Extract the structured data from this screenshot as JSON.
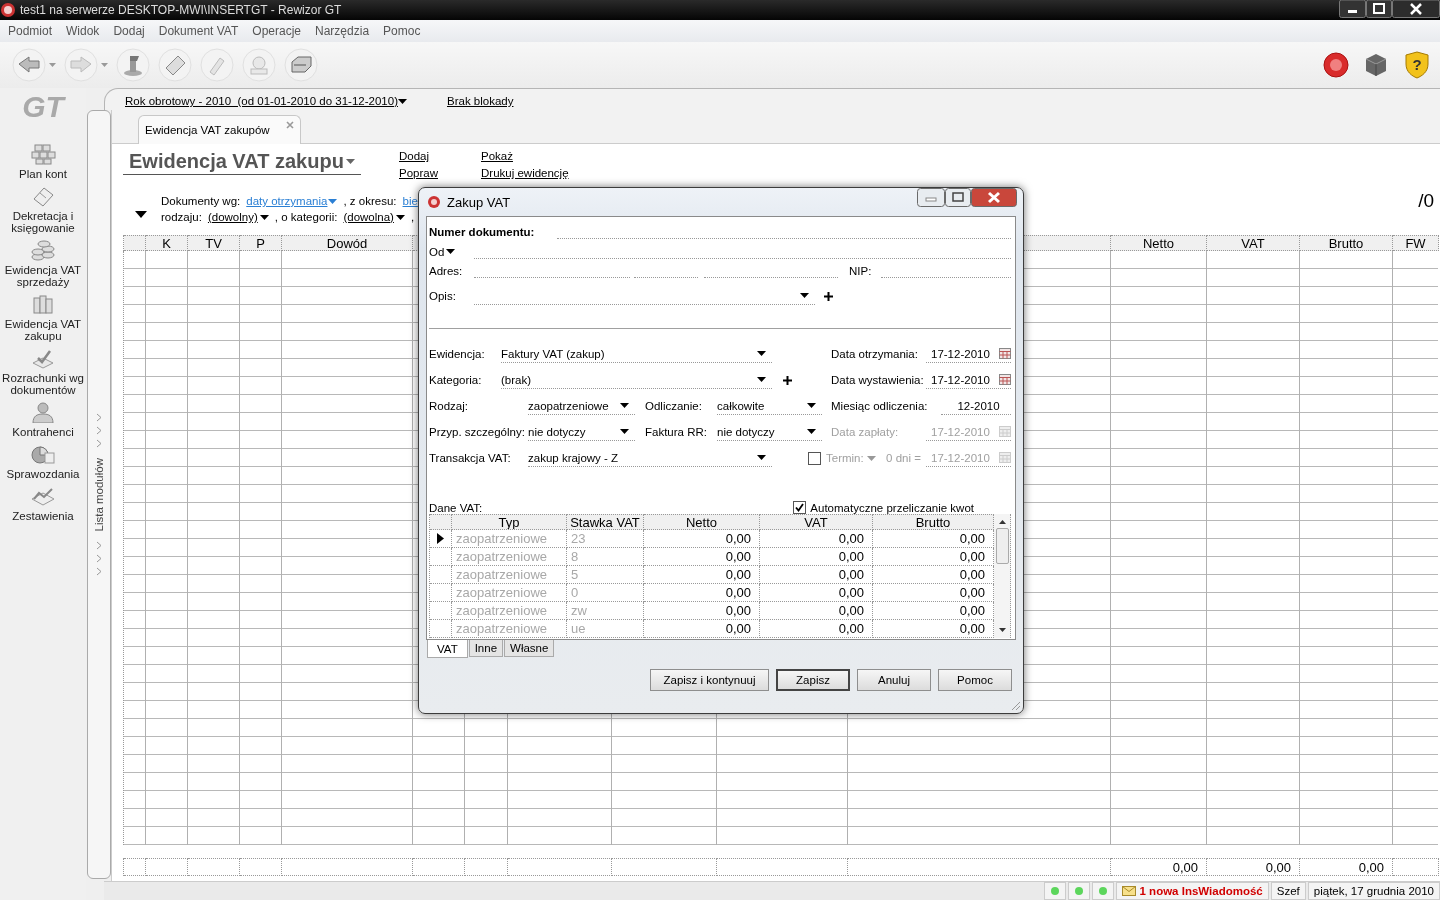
{
  "window": {
    "title": "test1 na serwerze DESKTOP-MWI\\INSERTGT - Rewizor GT"
  },
  "menu": [
    "Podmiot",
    "Widok",
    "Dodaj",
    "Dokument VAT",
    "Operacje",
    "Narzędzia",
    "Pomoc"
  ],
  "toolbar": {
    "help_glyph": "?"
  },
  "sidebar": {
    "logo": "GT",
    "strip_label": "Lista modułów",
    "items": [
      {
        "label": "Plan kont",
        "selected": false
      },
      {
        "label": "Dekretacja i księgowanie",
        "selected": false
      },
      {
        "label": "Ewidencja VAT sprzedaży",
        "selected": false
      },
      {
        "label": "Ewidencja VAT zakupu",
        "selected": false
      },
      {
        "label": "Rozrachunki wg dokumentów",
        "selected": false
      },
      {
        "label": "Kontrahenci",
        "selected": false
      },
      {
        "label": "Sprawozdania",
        "selected": false
      },
      {
        "label": "Zestawienia",
        "selected": false
      }
    ]
  },
  "period": {
    "label": "Rok obrotowy - 2010  (od 01-01-2010 do 31-12-2010)",
    "lock": "Brak blokady"
  },
  "tabs": [
    {
      "label": "Ewidencja VAT zakupów",
      "selected": true
    }
  ],
  "register": {
    "title": "Ewidencja VAT zakupu",
    "actions": [
      [
        "Dodaj",
        "Popraw"
      ],
      [
        "Pokaż",
        "Drukuj ewidencję"
      ]
    ],
    "counter": "/0"
  },
  "filters": [
    [
      {
        "kind": "label",
        "text": "Dokumenty wg:"
      },
      {
        "kind": "link",
        "text": "daty otrzymania"
      },
      {
        "kind": "label",
        "text": ", z okresu:"
      },
      {
        "kind": "cut-link",
        "text": "bie"
      }
    ],
    [
      {
        "kind": "label",
        "text": "rodzaju:"
      },
      {
        "kind": "dropdown",
        "text": "(dowolny)"
      },
      {
        "kind": "label",
        "text": ", o kategorii:"
      },
      {
        "kind": "dropdown",
        "text": "(dowolna)"
      },
      {
        "kind": "label",
        "text": ","
      }
    ]
  ],
  "table": {
    "columns_left": [
      "K",
      "TV",
      "P",
      "Dowód"
    ],
    "columns_right": [
      "Netto",
      "VAT",
      "Brutto",
      "FW"
    ],
    "totals": [
      "0,00",
      "0,00",
      "0,00"
    ]
  },
  "dialog": {
    "title": "Zakup VAT",
    "number_label": "Numer dokumentu:",
    "from_label": "Od",
    "address_label": "Adres:",
    "nip_label": "NIP:",
    "description_label": "Opis:",
    "ewidencja": {
      "label": "Ewidencja:",
      "value": "Faktury VAT (zakup)"
    },
    "kategoria": {
      "label": "Kategoria:",
      "value": "(brak)"
    },
    "rodzaj": {
      "label": "Rodzaj:",
      "value": "zaopatrzeniowe"
    },
    "odliczanie": {
      "label": "Odliczanie:",
      "value": "całkowite"
    },
    "przyp": {
      "label": "Przyp. szczególny:",
      "value": "nie dotyczy"
    },
    "faktura_rr": {
      "label": "Faktura RR:",
      "value": "nie dotyczy"
    },
    "transakcja": {
      "label": "Transakcja VAT:",
      "value": "zakup krajowy - Z"
    },
    "data_otrzymania": {
      "label": "Data otrzymania:",
      "value": "17-12-2010",
      "disabled": false
    },
    "data_wystawienia": {
      "label": "Data wystawienia:",
      "value": "17-12-2010",
      "disabled": false
    },
    "miesiac": {
      "label": "Miesiąc odliczenia:",
      "value": "12-2010"
    },
    "data_zaplaty": {
      "label": "Data zapłaty:",
      "value": "17-12-2010",
      "disabled": true
    },
    "termin": {
      "label": "Termin:",
      "checked": false,
      "days": "0 dni =",
      "value": "17-12-2010",
      "disabled": true
    },
    "vat_label": "Dane VAT:",
    "auto_recalc": {
      "label": "Automatyczne przeliczanie kwot",
      "checked": true
    },
    "vat_table": {
      "columns": [
        "Typ",
        "Stawka VAT",
        "Netto",
        "VAT",
        "Brutto"
      ],
      "rows": [
        {
          "type": "zaopatrzeniowe",
          "rate": "23",
          "net": "0,00",
          "vat": "0,00",
          "gross": "0,00",
          "selected": true
        },
        {
          "type": "zaopatrzeniowe",
          "rate": "8",
          "net": "0,00",
          "vat": "0,00",
          "gross": "0,00",
          "selected": false
        },
        {
          "type": "zaopatrzeniowe",
          "rate": "5",
          "net": "0,00",
          "vat": "0,00",
          "gross": "0,00",
          "selected": false
        },
        {
          "type": "zaopatrzeniowe",
          "rate": "0",
          "net": "0,00",
          "vat": "0,00",
          "gross": "0,00",
          "selected": false
        },
        {
          "type": "zaopatrzeniowe",
          "rate": "zw",
          "net": "0,00",
          "vat": "0,00",
          "gross": "0,00",
          "selected": false
        },
        {
          "type": "zaopatrzeniowe",
          "rate": "ue",
          "net": "0,00",
          "vat": "0,00",
          "gross": "0,00",
          "selected": false
        }
      ]
    },
    "tabs": [
      {
        "label": "VAT",
        "selected": true
      },
      {
        "label": "Inne",
        "selected": false
      },
      {
        "label": "Własne",
        "selected": false
      }
    ],
    "buttons": [
      {
        "label": "Zapisz i kontynuuj",
        "default": false
      },
      {
        "label": "Zapisz",
        "default": true
      },
      {
        "label": "Anuluj",
        "default": false
      },
      {
        "label": "Pomoc",
        "default": false
      }
    ]
  },
  "status": {
    "message": "1 nowa InsWiadomość",
    "user": "Szef",
    "date": "piątek, 17 grudnia 2010"
  }
}
